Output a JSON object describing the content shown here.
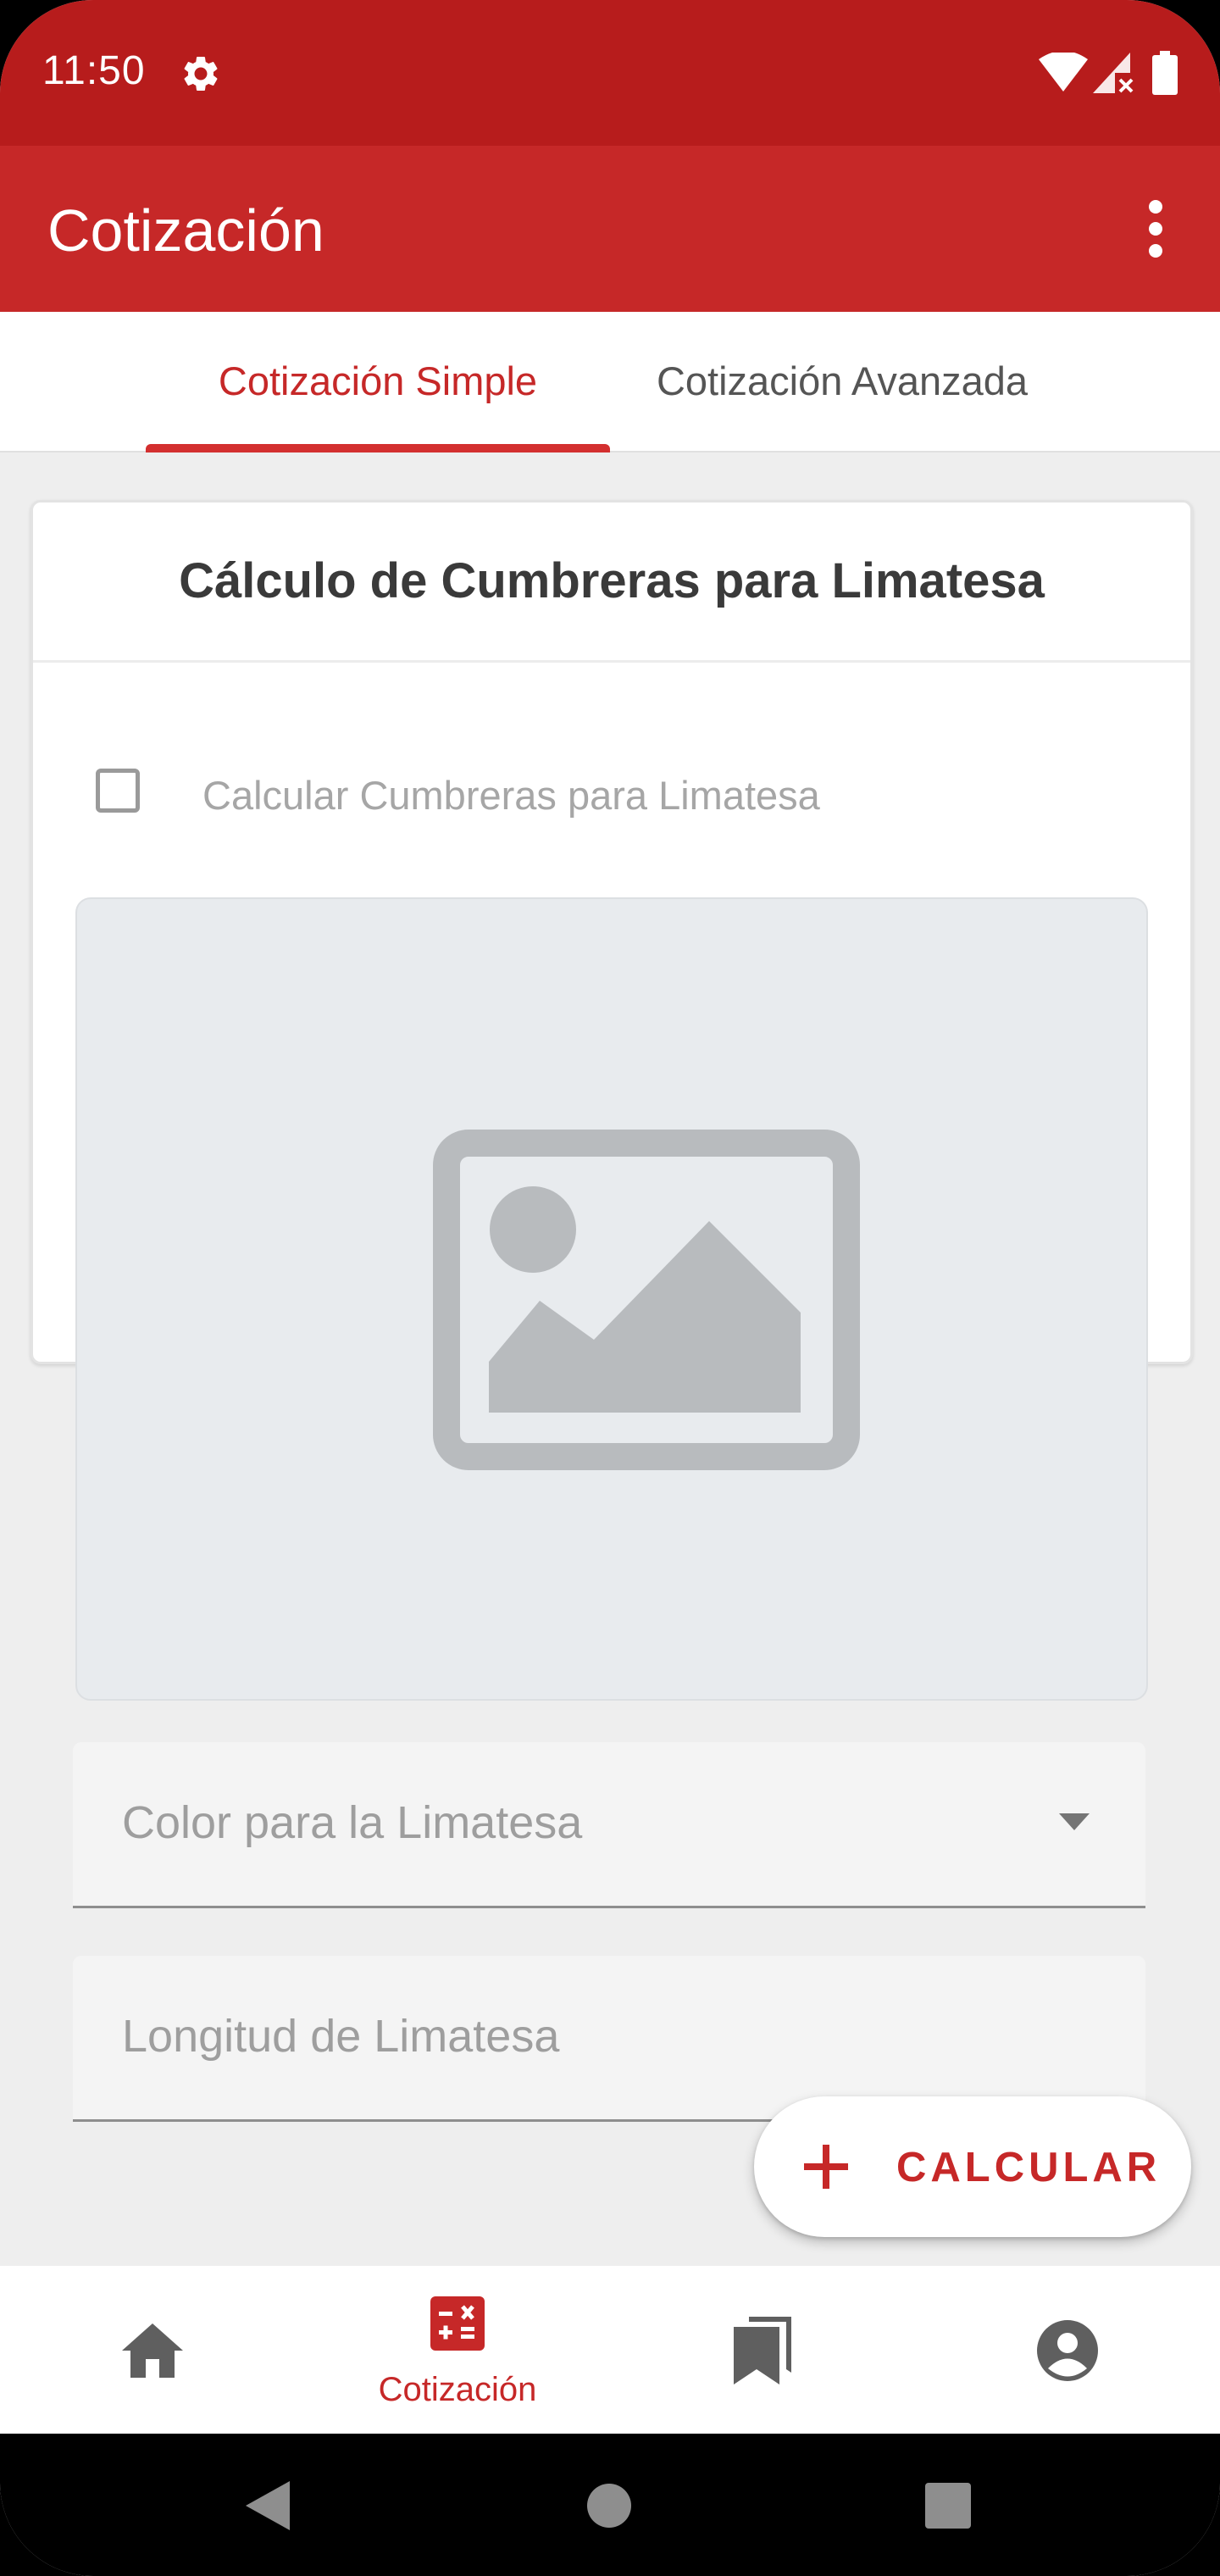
{
  "status_bar": {
    "time": "11:50",
    "icons": [
      "gear-icon",
      "wifi-icon",
      "signal-icon",
      "battery-icon"
    ]
  },
  "app_bar": {
    "title": "Cotización",
    "menu_icon": "more-vert-icon"
  },
  "tabs": [
    {
      "label": "Cotización Simple",
      "selected": true
    },
    {
      "label": "Cotización Avanzada",
      "selected": false
    }
  ],
  "card": {
    "title": "Cálculo de Cumbreras para Limatesa",
    "checkbox": {
      "label": "Calcular Cumbreras para Limatesa",
      "checked": false
    },
    "image_placeholder_icon": "image-icon",
    "color_field": {
      "placeholder": "Color para la Limatesa",
      "icon": "arrow-drop-down-icon"
    },
    "length_field": {
      "placeholder": "Longitud de Limatesa"
    }
  },
  "fab": {
    "label": "CALCULAR",
    "icon": "plus-icon"
  },
  "bottom_nav": [
    {
      "icon": "home-icon",
      "label": "",
      "selected": false
    },
    {
      "icon": "calculator-icon",
      "label": "Cotización",
      "selected": true
    },
    {
      "icon": "bookmarks-icon",
      "label": "",
      "selected": false
    },
    {
      "icon": "account-icon",
      "label": "",
      "selected": false
    }
  ],
  "colors": {
    "status_bar": "#b71c1c",
    "app_bar": "#c62828",
    "accent": "#c62828",
    "background": "#eeeeee"
  }
}
